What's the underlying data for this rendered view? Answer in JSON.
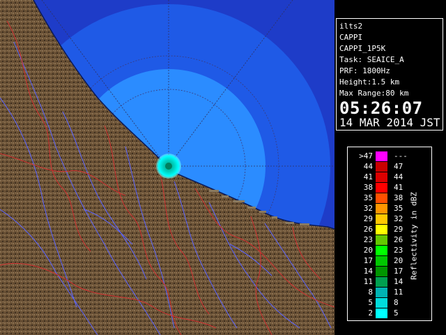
{
  "header": {
    "radar_id": "ilts2",
    "product": "CAPPI",
    "product_code": "CAPPI_1P5K",
    "task": "Task: SEAICE_A",
    "prf": "PRF: 1800Hz",
    "height": "Height:1.5 km",
    "max_range": "Max Range:80 km",
    "time": "05:26:07",
    "date": "14 MAR 2014 JST"
  },
  "legend": {
    "units_label": "Reflectivity in dBZ",
    "levels": [
      {
        "low": ">47",
        "high": "---",
        "color": "#ff00ff"
      },
      {
        "low": "44",
        "high": "47",
        "color": "#c80000"
      },
      {
        "low": "41",
        "high": "44",
        "color": "#dc0000"
      },
      {
        "low": "38",
        "high": "41",
        "color": "#ff0000"
      },
      {
        "low": "35",
        "high": "38",
        "color": "#ff5000"
      },
      {
        "low": "32",
        "high": "35",
        "color": "#ff9600"
      },
      {
        "low": "29",
        "high": "32",
        "color": "#ffc800"
      },
      {
        "low": "26",
        "high": "29",
        "color": "#ffff00"
      },
      {
        "low": "23",
        "high": "26",
        "color": "#64c800"
      },
      {
        "low": "20",
        "high": "23",
        "color": "#00ff00"
      },
      {
        "low": "17",
        "high": "20",
        "color": "#00c800"
      },
      {
        "low": "14",
        "high": "17",
        "color": "#009600"
      },
      {
        "low": "11",
        "high": "14",
        "color": "#00a050"
      },
      {
        "low": "8",
        "high": "11",
        "color": "#00b4b4"
      },
      {
        "low": "5",
        "high": "8",
        "color": "#00dcdc"
      },
      {
        "low": "2",
        "high": "5",
        "color": "#00ffff"
      }
    ]
  },
  "colors": {
    "sea_outer": "#1e3cc8",
    "sea_ring": "#1f5ae6",
    "echo_disc": "#2b8cff",
    "land": "#6b5236",
    "rivers": "#5a64ff",
    "boundaries": "#d03030",
    "echo_center": "#00d0c0"
  }
}
